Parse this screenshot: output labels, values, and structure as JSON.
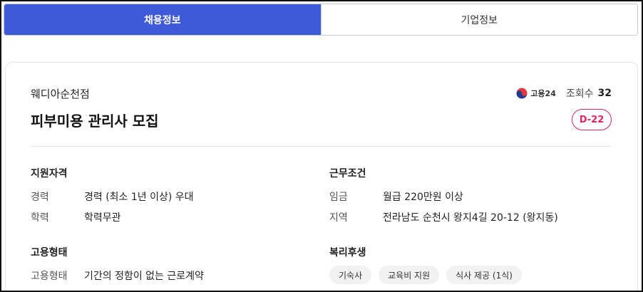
{
  "tabs": {
    "job_info": "채용정보",
    "company_info": "기업정보"
  },
  "posting": {
    "company": "웨디아순천점",
    "title": "피부미용 관리사 모집",
    "source_logo_text": "고용24",
    "views_label": "조회수",
    "views_count": "32",
    "dday": "D-22"
  },
  "qualifications": {
    "heading": "지원자격",
    "career_label": "경력",
    "career_value": "경력 (최소 1년 이상) 우대",
    "education_label": "학력",
    "education_value": "학력무관"
  },
  "conditions": {
    "heading": "근무조건",
    "wage_label": "임금",
    "wage_value": "월급 220만원 이상",
    "region_label": "지역",
    "region_value": "전라남도 순천시 왕지4길 20-12 (왕지동)"
  },
  "employment": {
    "heading": "고용형태",
    "type_label": "고용형태",
    "type_value": "기간의 정함이 없는 근로계약"
  },
  "benefits": {
    "heading": "복리후생",
    "items": [
      "기숙사",
      "교육비 지원",
      "식사 제공 (1식)"
    ]
  },
  "colors": {
    "accent": "#3f5ad8",
    "dday": "#e0245e"
  }
}
